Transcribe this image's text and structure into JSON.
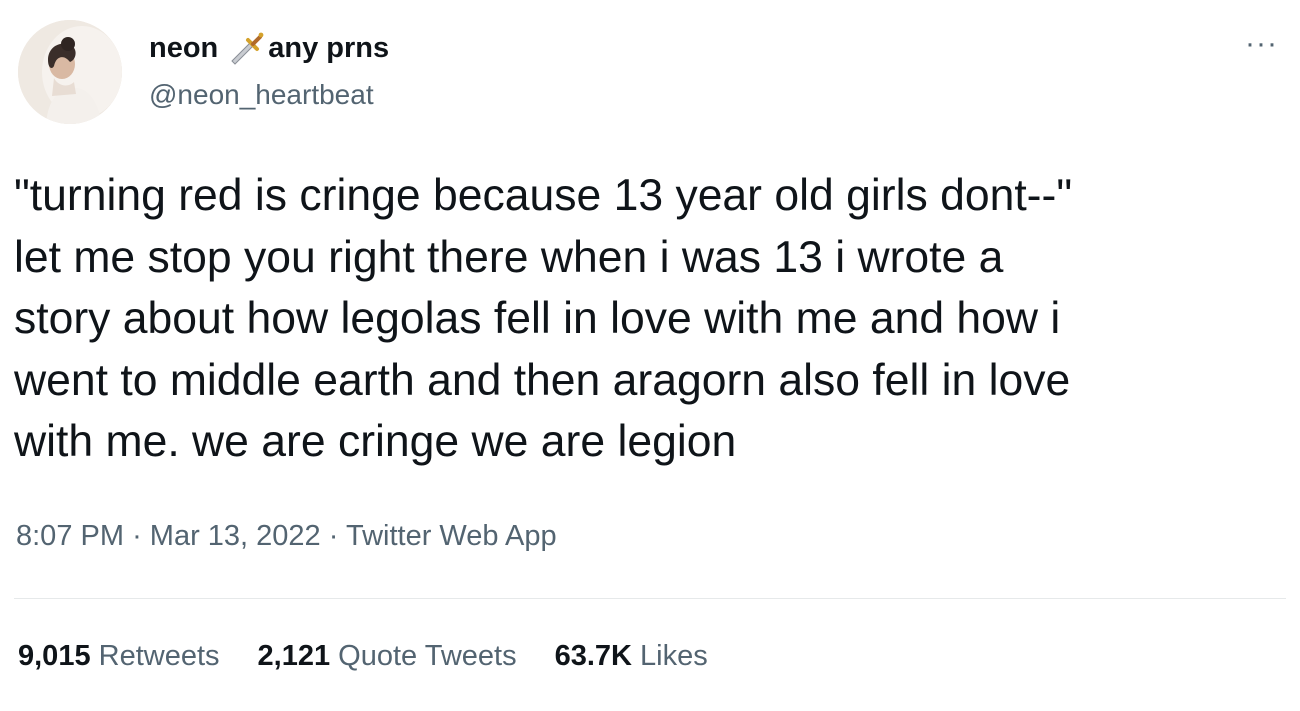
{
  "author": {
    "name_first": "neon",
    "name_emoji": "dagger-emoji",
    "name_rest": "any prns",
    "handle": "@neon_heartbeat"
  },
  "tweet": {
    "text": "\"turning red is cringe because 13 year old girls dont--\"\nlet me stop you right there when i was 13 i wrote a\nstory about how legolas fell in love with me and how i\nwent to middle earth and then aragorn also fell in love\nwith me. we are cringe we are legion",
    "time": "8:07 PM",
    "date": "Mar 13, 2022",
    "source": "Twitter Web App",
    "separator": "·"
  },
  "stats": {
    "retweets_count": "9,015",
    "retweets_label": "Retweets",
    "quotes_count": "2,121",
    "quotes_label": "Quote Tweets",
    "likes_count": "63.7K",
    "likes_label": "Likes"
  },
  "icons": {
    "more": "more-icon",
    "avatar": "avatar"
  }
}
